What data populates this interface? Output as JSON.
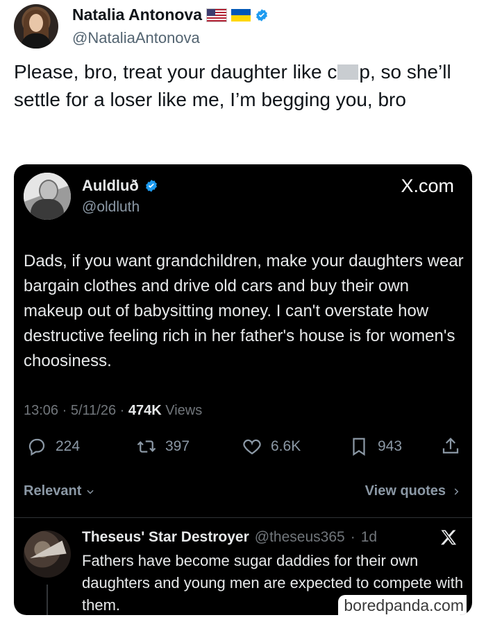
{
  "outer_post": {
    "author_name": "Natalia Antonova",
    "author_handle": "@NataliaAntonova",
    "text_before_censor": "Please, bro, treat your daughter like c",
    "text_after_censor": "p, so she’ll settle for a loser like me, I’m begging you, bro",
    "flags": [
      "us-flag-icon",
      "ukraine-flag-icon"
    ],
    "verified": true
  },
  "embedded_post": {
    "author_name": "Auldluð",
    "author_handle": "@oldluth",
    "source_label": "X.com",
    "verified": true,
    "text": "Dads, if you want grandchildren, make your daughters wear bargain clothes and drive old cars and buy their own makeup out of babysitting money. I can't overstate how destructive feeling rich in her father's house is for women's choosiness.",
    "time": "13:06",
    "date": "5/11/26",
    "views_count": "474K",
    "views_label": "Views",
    "actions": {
      "replies": "224",
      "reposts": "397",
      "likes": "6.6K",
      "bookmarks": "943"
    },
    "relevant_label": "Relevant",
    "view_quotes_label": "View quotes"
  },
  "reply": {
    "author_name": "Theseus' Star Destroyer",
    "author_handle": "@theseus365",
    "age": "1d",
    "text": "Fathers have become sugar daddies for their own daughters and young men are expected to compete with them."
  },
  "watermark": "boredpanda.com",
  "colors": {
    "verified_blue": "#1d9bf0",
    "dark_bg": "#000000",
    "muted_text": "#71767b"
  }
}
